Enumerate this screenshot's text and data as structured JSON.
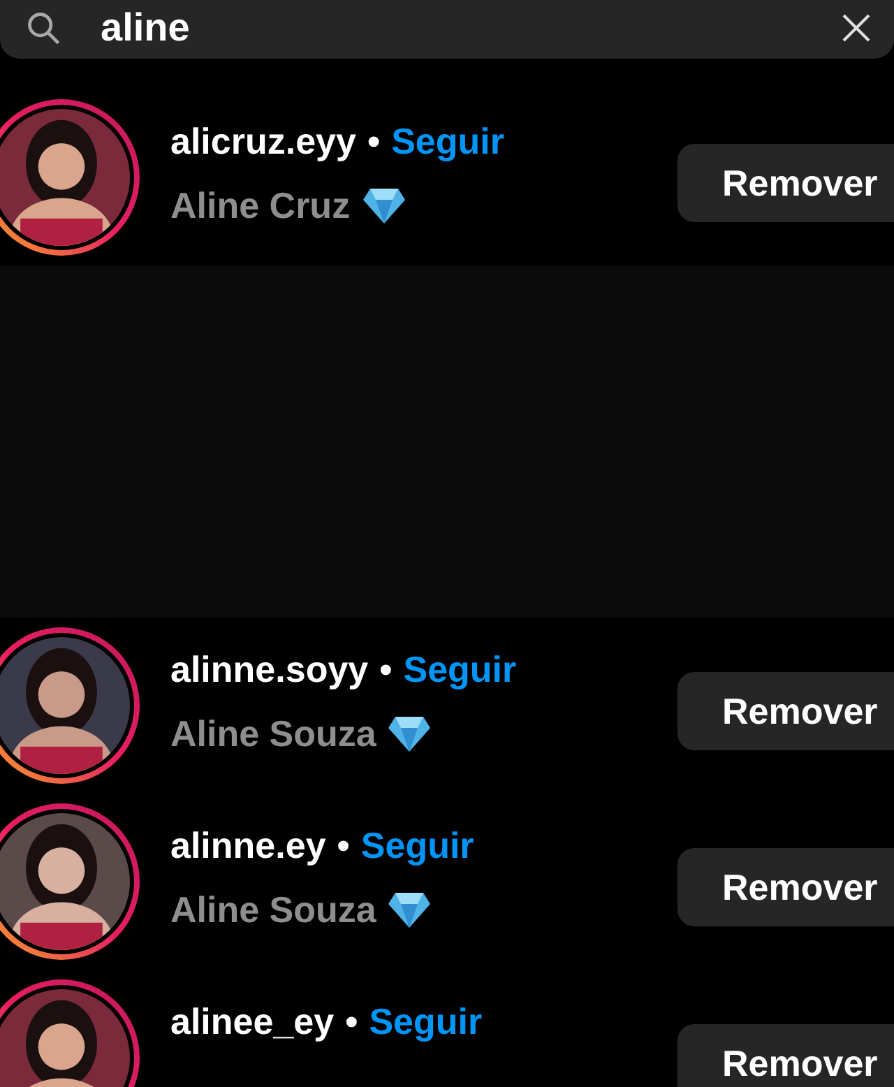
{
  "search": {
    "value": "aline"
  },
  "results": [
    {
      "kind": "account",
      "username": "alicruz.eyy",
      "separator": "•",
      "follow": "Seguir",
      "name": "Aline Cruz",
      "button": "Remover"
    },
    {
      "kind": "blank"
    },
    {
      "kind": "account",
      "username": "alinne.soyy",
      "separator": "•",
      "follow": "Seguir",
      "name": "Aline Souza",
      "button": "Remover"
    },
    {
      "kind": "account",
      "username": "alinne.ey",
      "separator": "•",
      "follow": "Seguir",
      "name": "Aline Souza",
      "button": "Remover"
    },
    {
      "kind": "account",
      "username": "alinee_ey",
      "separator": "•",
      "follow": "Seguir",
      "button": "Remover"
    }
  ]
}
